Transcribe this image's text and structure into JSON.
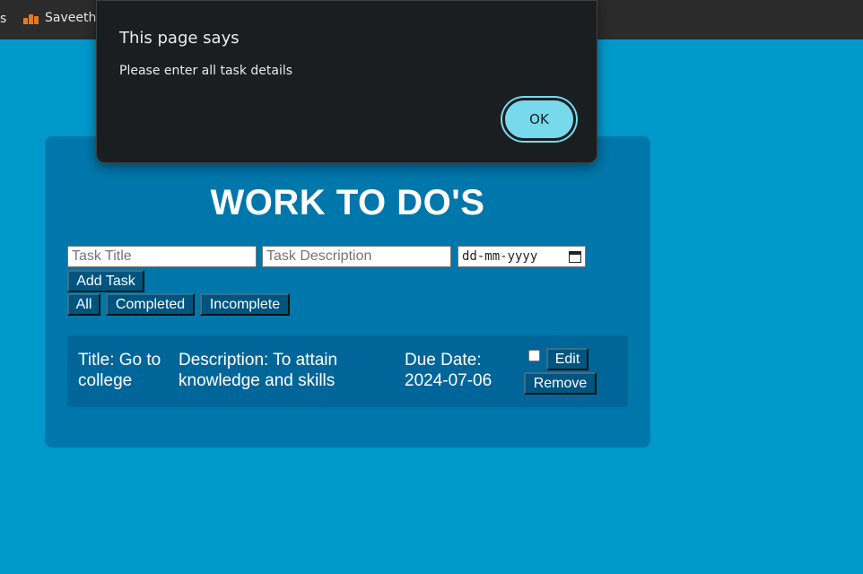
{
  "browser": {
    "bookmark_fragment": "s",
    "bookmark_label": "Saveetha"
  },
  "app": {
    "title": "WORK TO DO'S",
    "inputs": {
      "title_placeholder": "Task Title",
      "description_placeholder": "Task Description",
      "date_placeholder": "dd-mm-yyyy"
    },
    "add_button": "Add Task",
    "filters": [
      "All",
      "Completed",
      "Incomplete"
    ],
    "tasks": [
      {
        "title_line1": "Title: Go to",
        "title_line2": "college",
        "desc_line1": "Description: To attain",
        "desc_line2": "knowledge and skills",
        "due_line1": "Due Date:",
        "due_line2": "2024-07-06",
        "completed": false,
        "edit_label": "Edit",
        "remove_label": "Remove"
      }
    ]
  },
  "dialog": {
    "title": "This page says",
    "message": "Please enter all task details",
    "ok_label": "OK"
  },
  "colors": {
    "page_bg": "#0099cc",
    "card_bg": "#0077aa",
    "task_bg": "#006699",
    "button_bg": "#005580",
    "dialog_bg": "#1b1e21",
    "ok_accent": "#78d9ec"
  }
}
